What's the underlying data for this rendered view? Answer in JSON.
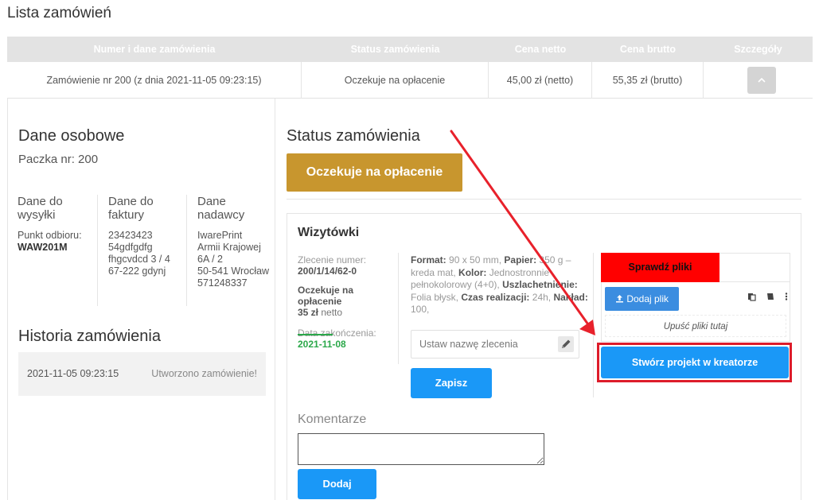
{
  "page": {
    "title": "Lista zamówień"
  },
  "table": {
    "headers": [
      "Numer i dane zamówienia",
      "Status zamówienia",
      "Cena netto",
      "Cena brutto",
      "Szczegóły"
    ],
    "row": {
      "order": "Zamówienie nr 200 (z dnia 2021-11-05 09:23:15)",
      "status": "Oczekuje na opłacenie",
      "net": "45,00 zł (netto)",
      "gross": "55,35 zł (brutto)",
      "toggle_icon": "chevron-up-icon"
    }
  },
  "personal": {
    "heading": "Dane osobowe",
    "package": "Paczka nr: 200",
    "shipping": {
      "heading": "Dane do wysyłki",
      "line1": "Punkt odbioru:",
      "line2": "WAW201M"
    },
    "invoice": {
      "heading": "Dane do faktury",
      "line1": "23423423",
      "line2": "54gdfgdfg",
      "line3": "fhgcvdcd 3 / 4",
      "line4": "67-222 gdynj"
    },
    "sender": {
      "heading": "Dane nadawcy",
      "line1": "IwarePrint",
      "line2": "Armii Krajowej 6A / 2",
      "line3": "50-541 Wrocław",
      "line4": "571248337"
    }
  },
  "history": {
    "heading": "Historia zamówienia",
    "items": [
      {
        "date": "2021-11-05 09:23:15",
        "event": "Utworzono zamówienie!"
      }
    ]
  },
  "status": {
    "heading": "Status zamówienia",
    "badge": "Oczekuje na opłacenie",
    "badge_color": "#c8962e"
  },
  "product": {
    "title": "Wizytówki",
    "order_number_label": "Zlecenie numer:",
    "order_number": "200/1/14/62-0",
    "state": "Oczekuje na opłacenie",
    "price": "35 zł",
    "price_suffix": "netto",
    "end_date_label": "Data zakończenia:",
    "end_date": "2021-11-08",
    "specs": {
      "format_label": "Format:",
      "format": "90 x 50 mm,",
      "paper_label": "Papier:",
      "paper": "350 g – kreda mat,",
      "color_label": "Kolor:",
      "color": "Jednostronnie pełnokolorowy (4+0),",
      "finish_label": "Uszlachetnienie:",
      "finish": "Folia błysk,",
      "time_label": "Czas realizacji:",
      "time": "24h,",
      "qty_label": "Nakład:",
      "qty": "100,"
    },
    "name_placeholder": "Ustaw nazwę zlecenia",
    "save_label": "Zapisz"
  },
  "files": {
    "check_label": "Sprawdź pliki",
    "add_label": "Dodaj plik",
    "drop_label": "Upuść pliki tutaj",
    "creator_label": "Stwórz projekt w kreatorze",
    "accent": "#1a98f7",
    "alert": "#ff0000"
  },
  "comments": {
    "heading": "Komentarze",
    "add_label": "Dodaj"
  }
}
